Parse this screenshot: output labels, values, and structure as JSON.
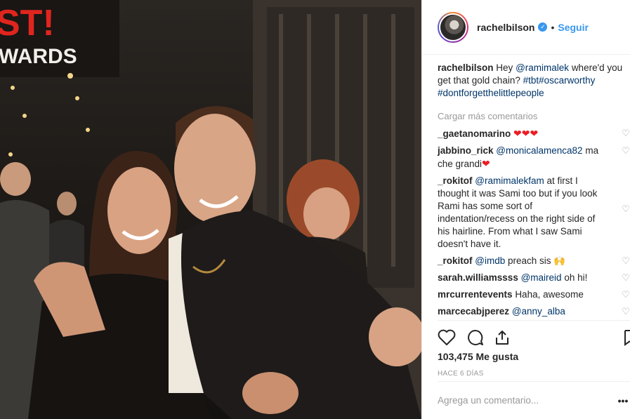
{
  "header": {
    "username": "rachelbilson",
    "separator": "•",
    "follow_label": "Seguir"
  },
  "caption": {
    "username": "rachelbilson",
    "text_1": "Hey",
    "mention": "@ramimalek",
    "text_2": "where'd you get that gold chain?",
    "tag_1": "#tbt",
    "tag_2": "#oscarworthy",
    "tag_3": "#dontforgetthelittlepeople"
  },
  "load_more_label": "Cargar más comentarios",
  "comments": [
    {
      "username": "_gaetanomarino",
      "text": ""
    },
    {
      "username": "jabbino_rick",
      "mention": "@monicalamenca82",
      "text": "ma che grandi"
    },
    {
      "username": "_rokitof",
      "mention": "@ramimalekfam",
      "text": "at first I thought it was Sami too but if you look Rami has some sort of indentation/recess on the right side of his hairline. From what I saw Sami doesn't have it."
    },
    {
      "username": "_rokitof",
      "mention": "@imdb",
      "text": "preach sis"
    },
    {
      "username": "sarah.williamssss",
      "mention": "@maireid",
      "text": "oh hi!"
    },
    {
      "username": "mrcurrentevents",
      "text": "Haha, awesome"
    },
    {
      "username": "marcecabjperez",
      "mention": "@anny_alba",
      "text": ""
    }
  ],
  "likes_label": "103,475 Me gusta",
  "time_label": "HACE 6 DÍAS",
  "add_comment": {
    "placeholder": "Agrega un comentario..."
  },
  "more_icon": "•••",
  "photo_sign": {
    "line_1": "ST!",
    "line_2": "WARDS"
  },
  "colors": {
    "accent": "#3897f0",
    "link": "#003569",
    "like_red": "#ed1c24"
  }
}
